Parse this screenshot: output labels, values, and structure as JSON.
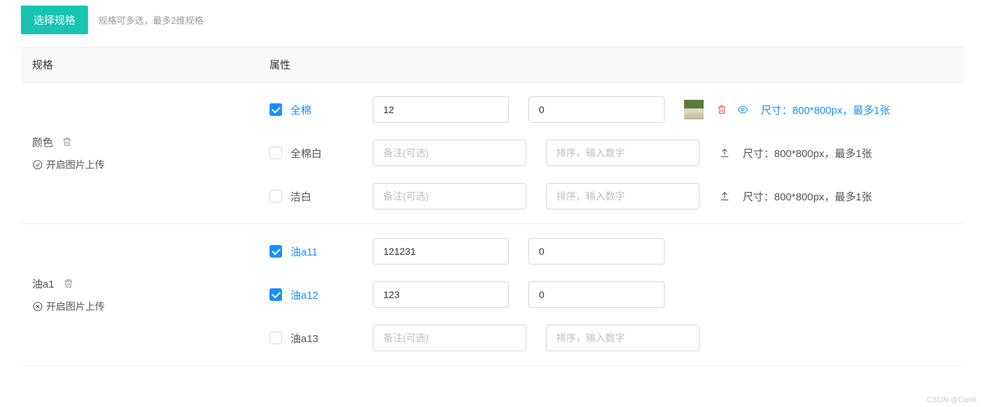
{
  "header": {
    "button": "选择规格",
    "hint": "规格可多选，最多2维规格"
  },
  "columns": {
    "spec": "规格",
    "attr": "属性"
  },
  "placeholders": {
    "remark": "备注(可选)",
    "sort": "排序，输入数字"
  },
  "sizeHint": "尺寸：800*800px，最多1张",
  "uploadToggle": "开启图片上传",
  "specs": [
    {
      "name": "颜色",
      "toggleState": "on",
      "attrs": [
        {
          "label": "全棉",
          "checked": true,
          "remark": "12",
          "sort": "0",
          "hasImage": true
        },
        {
          "label": "全棉白",
          "checked": false,
          "remark": "",
          "sort": "",
          "hasImage": false
        },
        {
          "label": "洁白",
          "checked": false,
          "remark": "",
          "sort": "",
          "hasImage": false
        }
      ]
    },
    {
      "name": "油a1",
      "toggleState": "off",
      "attrs": [
        {
          "label": "油a11",
          "checked": true,
          "remark": "121231",
          "sort": "0",
          "hasImage": false,
          "hideUpload": true
        },
        {
          "label": "油a12",
          "checked": true,
          "remark": "123",
          "sort": "0",
          "hasImage": false,
          "hideUpload": true
        },
        {
          "label": "油a13",
          "checked": false,
          "remark": "",
          "sort": "",
          "hasImage": false,
          "hideUpload": true
        }
      ]
    }
  ],
  "watermark": "CSDN @Danli."
}
